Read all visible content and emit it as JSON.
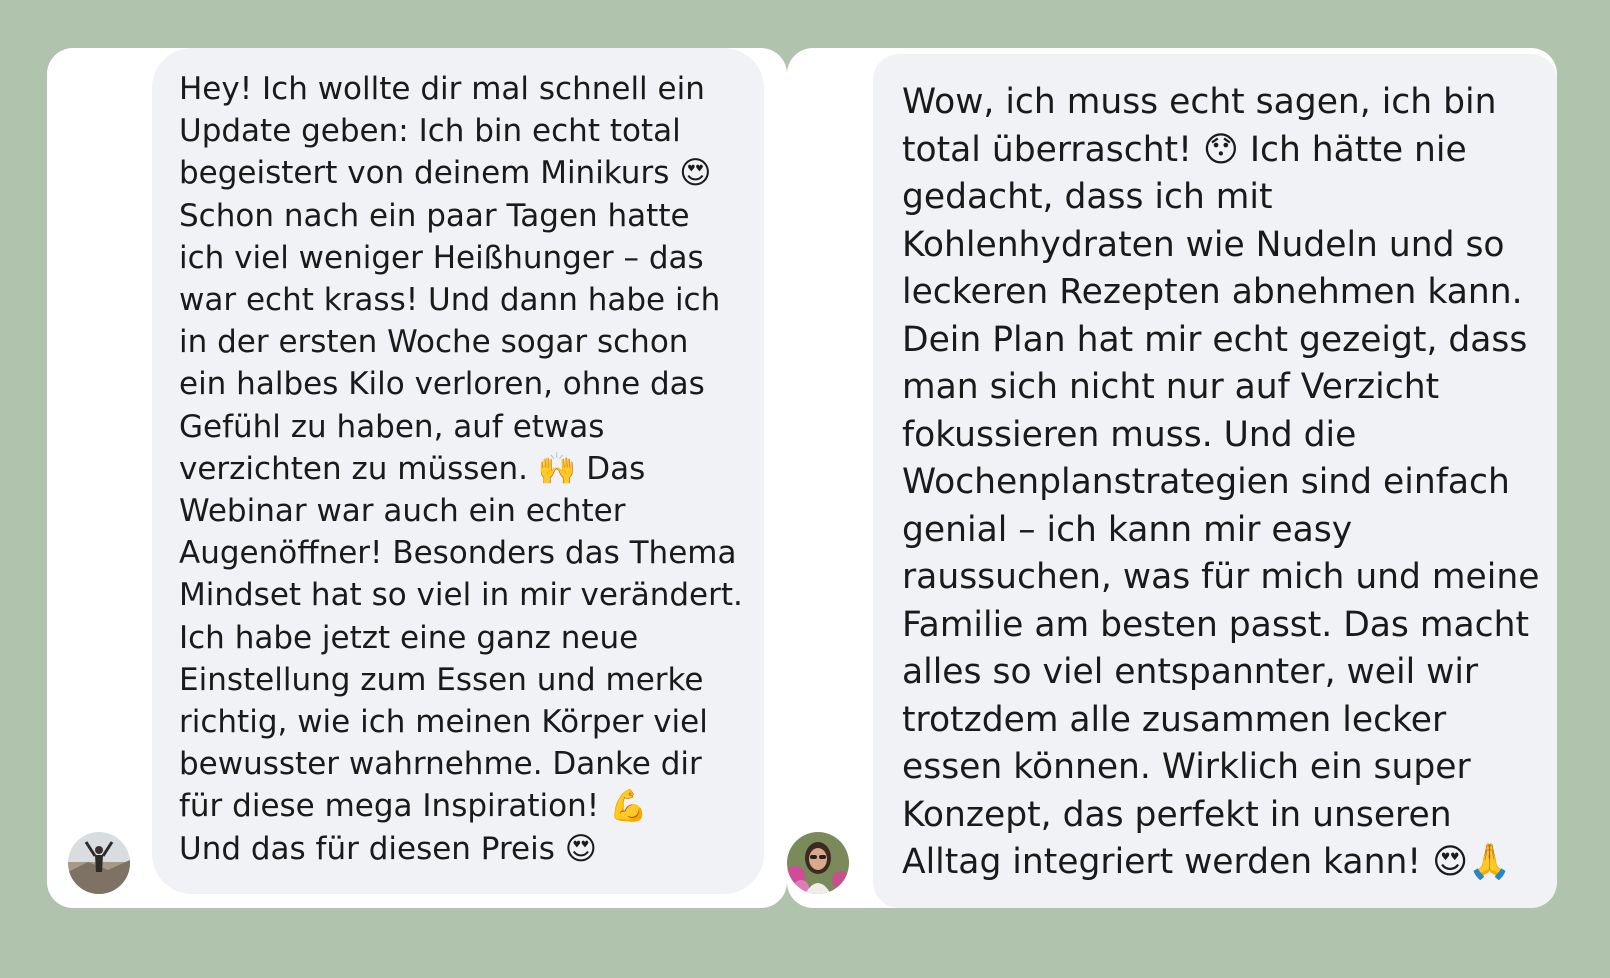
{
  "background_color": "#b0c3ad",
  "conversations": [
    {
      "avatar": {
        "icon": "hiker-avatar-icon"
      },
      "message": "Hey! Ich wollte dir mal schnell ein Update geben: Ich bin echt total begeistert von deinem Minikurs 😍 Schon nach ein paar Tagen hatte ich viel weniger Heißhunger – das war echt krass! Und dann habe ich in der ersten Woche sogar schon ein halbes Kilo verloren, ohne das Gefühl zu haben, auf etwas verzichten zu müssen. 🙌 Das Webinar war auch ein echter Augenöffner! Besonders das Thema Mindset hat so viel in mir verändert. Ich habe jetzt eine ganz neue Einstellung zum Essen und merke richtig, wie ich meinen Körper viel bewusster wahrnehme. Danke dir für diese mega Inspiration! 💪",
      "message_line2": "Und das für diesen Preis 😍"
    },
    {
      "avatar": {
        "icon": "woman-flowers-avatar-icon"
      },
      "message": "Wow, ich muss echt sagen, ich bin total überrascht! 😯 Ich hätte nie gedacht, dass ich mit Kohlenhydraten wie Nudeln und so leckeren Rezepten abnehmen kann. Dein Plan hat mir echt gezeigt, dass man sich nicht nur auf Verzicht fokussieren muss. Und die Wochenplanstrategien sind einfach genial – ich kann mir easy raussuchen, was für mich und meine Familie am besten passt. Das macht alles so viel entspannter, weil wir trotzdem alle zusammen lecker essen können. Wirklich ein super Konzept, das perfekt in unseren Alltag integriert werden kann! 😍🙏"
    }
  ]
}
